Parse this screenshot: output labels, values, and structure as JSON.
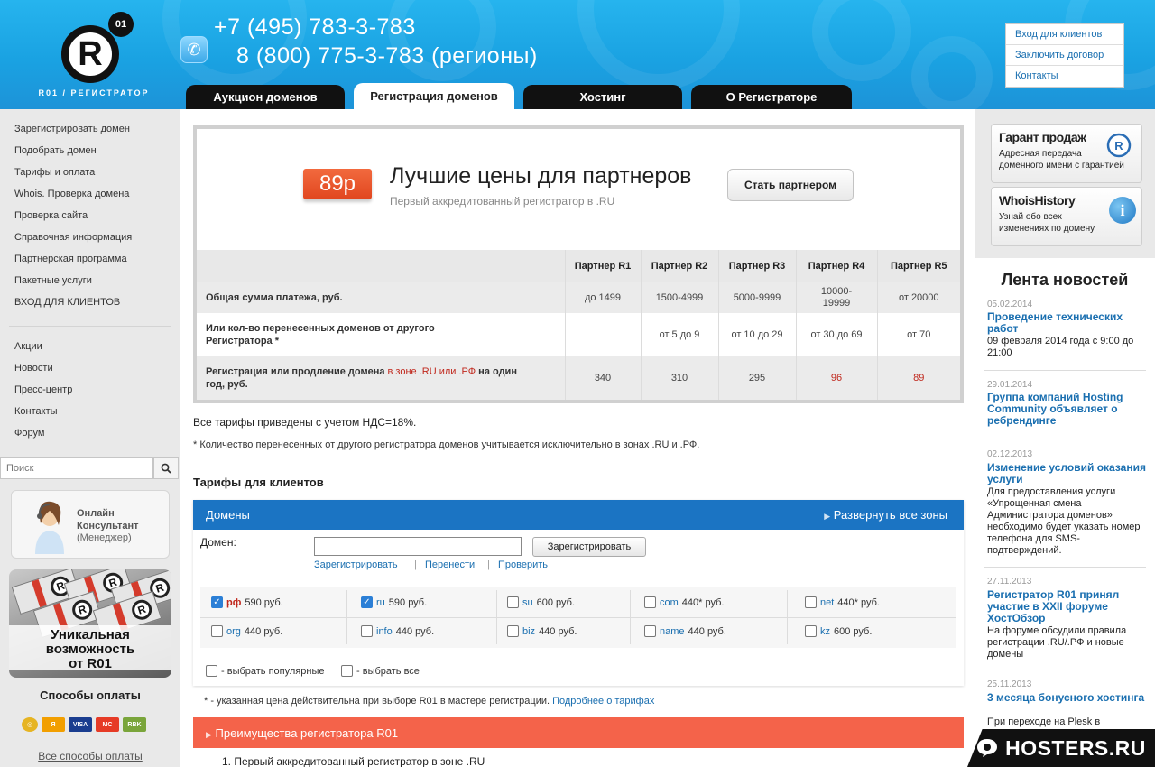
{
  "header": {
    "logo_text": "R01 / РЕГИСТРАТОР",
    "phone1": "+7 (495) 783-3-783",
    "phone2": "8 (800) 775-3-783 (регионы)",
    "tabs": [
      "Аукцион доменов",
      "Регистрация доменов",
      "Хостинг",
      "О Регистраторе"
    ],
    "active_tab": "Регистрация доменов",
    "toplinks": [
      "Вход для клиентов",
      "Заключить договор",
      "Контакты"
    ]
  },
  "left": {
    "nav1": [
      "Зарегистрировать домен",
      "Подобрать домен",
      "Тарифы и оплата",
      "Whois. Проверка домена",
      "Проверка сайта",
      "Справочная информация",
      "Партнерская программа",
      "Пакетные услуги",
      "ВХОД ДЛЯ КЛИЕНТОВ"
    ],
    "nav2": [
      "Акции",
      "Новости",
      "Пресс-центр",
      "Контакты",
      "Форум"
    ],
    "search_placeholder": "Поиск",
    "consult": {
      "line1": "Онлайн",
      "line2": "Консультант",
      "line3": "(Менеджер)"
    },
    "promo": {
      "line1": "Уникальная",
      "line2": "возможность",
      "line3": "от R01"
    },
    "pay_head": "Способы оплаты",
    "pay_icons": [
      "webmoney-icon",
      "yandex-money-icon",
      "visa-icon",
      "mastercard-icon",
      "rbk-money-icon"
    ],
    "all_pay": "Все способы оплаты"
  },
  "partner": {
    "price": "89р",
    "title": "Лучшие цены для партнеров",
    "subtitle": "Первый аккредитованный регистратор в .RU",
    "button": "Стать партнером",
    "columns": [
      "Партнер R1",
      "Партнер R2",
      "Партнер R3",
      "Партнер R4",
      "Партнер R5"
    ],
    "rows": [
      {
        "label": "Общая сумма платежа, руб.",
        "values": [
          "до 1499",
          "1500-4999",
          "5000-9999",
          "10000-19999",
          "от 20000"
        ]
      },
      {
        "label": "Или кол-во перенесенных доменов от другого Регистратора *",
        "values": [
          "",
          "от 5 до 9",
          "от 10 до 29",
          "от 30 до 69",
          "от 70"
        ]
      },
      {
        "label_a": "Регистрация или продление домена ",
        "label_link": "в зоне .RU или .РФ",
        "label_b": " на один год, руб.",
        "values": [
          "340",
          "310",
          "295",
          "96",
          "89"
        ]
      }
    ]
  },
  "vat": "Все тарифы приведены с учетом НДС=18%.",
  "note1": "* Количество перенесенных от другого регистратора доменов учитывается исключительно в зонах .RU  и .РФ.",
  "tariffs_head": "Тарифы для клиентов",
  "domains": {
    "bar_title": "Домены",
    "expand": "Развернуть все зоны",
    "label": "Домен:",
    "input_value": "",
    "register_btn": "Зарегистрировать",
    "links": [
      "Зарегистрировать",
      "Перенести",
      "Проверить"
    ],
    "zones": [
      {
        "name": "рф",
        "price": "590 руб.",
        "checked": true
      },
      {
        "name": "ru",
        "price": "590 руб.",
        "checked": true
      },
      {
        "name": "su",
        "price": "600 руб.",
        "checked": false
      },
      {
        "name": "com",
        "price": "440* руб.",
        "checked": false
      },
      {
        "name": "net",
        "price": "440* руб.",
        "checked": false
      },
      {
        "name": "org",
        "price": "440 руб.",
        "checked": false
      },
      {
        "name": "info",
        "price": "440 руб.",
        "checked": false
      },
      {
        "name": "biz",
        "price": "440 руб.",
        "checked": false
      },
      {
        "name": "name",
        "price": "440 руб.",
        "checked": false
      },
      {
        "name": "kz",
        "price": "600 руб.",
        "checked": false
      }
    ],
    "select_popular": "- выбрать популярные",
    "select_all": "- выбрать все"
  },
  "note2_text": "* - указанная цена действительна при выборе R01 в мастере регистрации.",
  "note2_link": "Подробнее о тарифах",
  "advantages": {
    "title": "Преимущества регистратора R01",
    "item1": "1. Первый аккредитованный регистратор в зоне .RU"
  },
  "right": {
    "box1": {
      "title": "Гарант продаж",
      "text1": "Адресная передача",
      "text2": "доменного имени с гарантией"
    },
    "box2": {
      "title": "WhoisHistory",
      "text1": "Узнай обо всех",
      "text2": "изменениях по домену"
    },
    "news_head": "Лента новостей",
    "news": [
      {
        "date": "05.02.2014",
        "title": "Проведение технических работ",
        "text": "09 февраля 2014 года с 9:00 до 21:00"
      },
      {
        "date": "29.01.2014",
        "title": "Группа компаний Hosting Community объявляет о ребрендинге",
        "text": ""
      },
      {
        "date": "02.12.2013",
        "title": "Изменение условий оказания услуги",
        "text": "Для предоставления услуги «Упрощенная смена Администратора доменов» необходимо будет указать номер телефона для SMS-подтверждений."
      },
      {
        "date": "27.11.2013",
        "title": "Регистратор R01 принял участие в XXII форуме ХостОбзор",
        "text": "На форуме обсудили правила регистрации .RU/.РФ и новые домены"
      },
      {
        "date": "25.11.2013",
        "title": "3 месяца бонусного хостинга",
        "text": "При переходе на Plesk в"
      }
    ]
  },
  "watermark": "HOSTERS.RU",
  "colors": {
    "header_blue": "#1aa2e2",
    "bar_blue": "#1b74c3",
    "advantage_red": "#f4634a",
    "price_orange": "#e1461f",
    "link_blue": "#1a6fb0"
  }
}
